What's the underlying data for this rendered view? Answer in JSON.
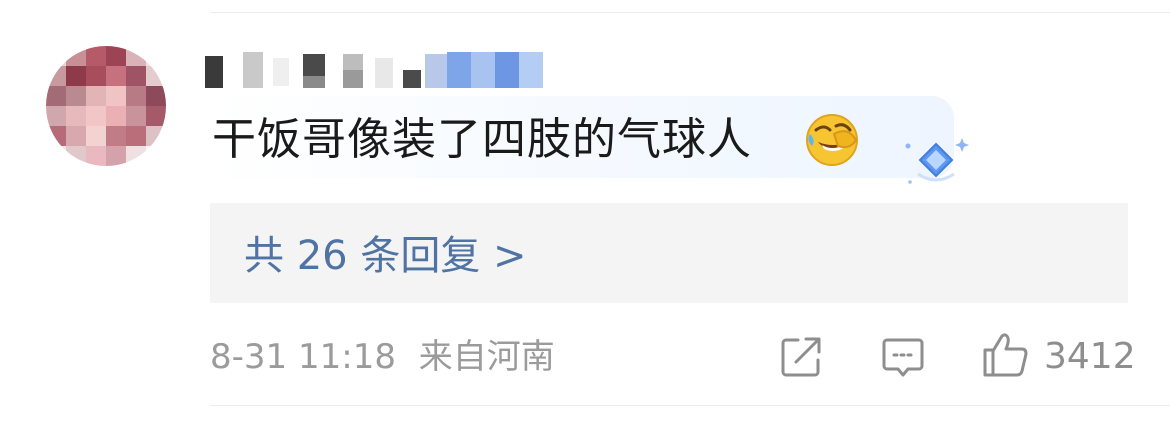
{
  "comment": {
    "text": "干饭哥像装了四肢的气球人"
  },
  "replies": {
    "link_label": "共 26 条回复 >"
  },
  "meta": {
    "timestamp": "8-31 11:18",
    "location": "来自河南"
  },
  "actions": {
    "like_count": "3412"
  },
  "icons": {
    "emoji": "laughing-crying-emoji-icon",
    "badge": "blue-diamond-badge-icon",
    "share": "share-icon",
    "comment": "comment-icon",
    "like": "thumbs-up-icon"
  },
  "colors": {
    "link": "#4f73a3",
    "meta_text": "#9b9b9b",
    "reply_bg": "#f4f4f4"
  }
}
